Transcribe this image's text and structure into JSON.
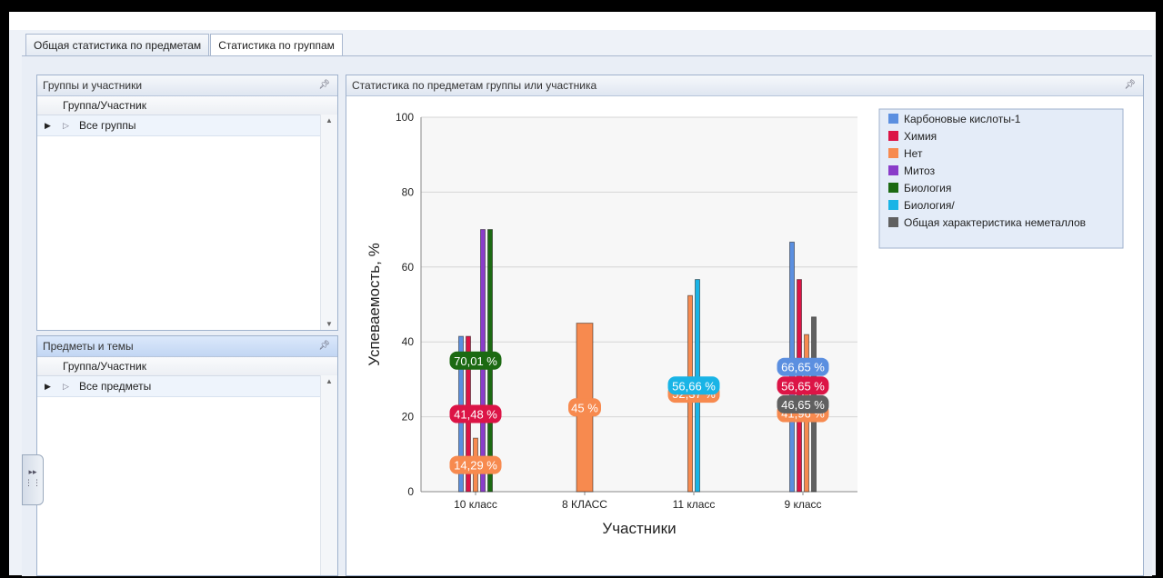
{
  "tabs": [
    {
      "label": "Общая статистика по предметам"
    },
    {
      "label": "Статистика по группам"
    }
  ],
  "groups_panel": {
    "title": "Группы и участники",
    "column": "Группа/Участник",
    "rows": [
      {
        "label": "Все группы"
      }
    ]
  },
  "subjects_panel": {
    "title": "Предметы и темы",
    "column": "Группа/Участник",
    "rows": [
      {
        "label": "Все предметы"
      }
    ]
  },
  "chart_panel": {
    "title": "Статистика по предметам группы или участника"
  },
  "icons": {
    "pin": "pin-icon",
    "row_selector": "row-selector-icon",
    "expander": "expand-arrow-icon",
    "side_handle": "dock-handle-icon"
  },
  "chart_data": {
    "type": "bar",
    "xlabel": "Участники",
    "ylabel": "Успеваемость, %",
    "ylim": [
      0,
      100
    ],
    "yticks": [
      0,
      20,
      40,
      60,
      80,
      100
    ],
    "grid": true,
    "legend_position": "top-right",
    "categories": [
      "10 класс",
      "8 КЛАСС",
      "11 класс",
      "9 класс"
    ],
    "series": [
      {
        "name": "Карбоновые кислоты-1",
        "color": "#5b8fe0",
        "values": [
          41.48,
          null,
          null,
          66.65
        ],
        "labels": [
          null,
          null,
          null,
          "66,65 %"
        ]
      },
      {
        "name": "Химия",
        "color": "#dc1446",
        "values": [
          41.48,
          null,
          null,
          56.65
        ],
        "labels": [
          "41,48 %",
          null,
          null,
          "56,65 %"
        ]
      },
      {
        "name": "Нет",
        "color": "#f78a4f",
        "values": [
          14.29,
          45,
          52.37,
          41.96
        ],
        "labels": [
          "14,29 %",
          "45 %",
          "52,37 %",
          "41,96 %"
        ]
      },
      {
        "name": "Митоз",
        "color": "#8a3cc9",
        "values": [
          70.01,
          null,
          null,
          null
        ],
        "labels": [
          null,
          null,
          null,
          null
        ]
      },
      {
        "name": "Биология",
        "color": "#1c6a12",
        "values": [
          70.01,
          null,
          null,
          null
        ],
        "labels": [
          "70,01 %",
          null,
          null,
          null
        ]
      },
      {
        "name": "Биология/",
        "color": "#19b4e6",
        "values": [
          null,
          null,
          56.66,
          null
        ],
        "labels": [
          null,
          null,
          "56,66 %",
          null
        ]
      },
      {
        "name": "Общая характеристика неметаллов",
        "color": "#606060",
        "values": [
          null,
          null,
          null,
          46.65
        ],
        "labels": [
          null,
          null,
          null,
          "46,65 %"
        ]
      }
    ]
  }
}
